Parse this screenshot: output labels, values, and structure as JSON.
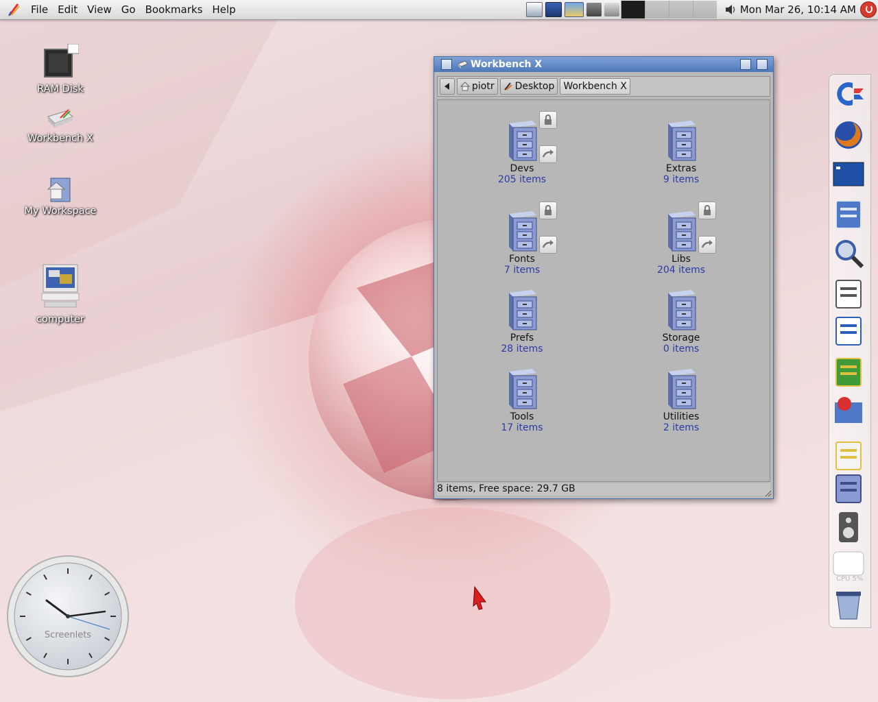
{
  "topbar": {
    "menu": [
      "File",
      "Edit",
      "View",
      "Go",
      "Bookmarks",
      "Help"
    ],
    "datetime": "Mon Mar 26, 10:14 AM"
  },
  "desktop": {
    "icons": [
      {
        "label": "RAM Disk",
        "icon": "ram-disk-icon"
      },
      {
        "label": "Workbench X",
        "icon": "workbench-drive-icon"
      },
      {
        "label": "My Workspace",
        "icon": "workspace-icon"
      },
      {
        "label": "computer",
        "icon": "computer-icon"
      }
    ]
  },
  "window": {
    "title": "Workbench X",
    "path": [
      "piotr",
      "Desktop",
      "Workbench X"
    ],
    "items": [
      {
        "name": "Devs",
        "count": "205 items",
        "locked": true,
        "link": true
      },
      {
        "name": "Extras",
        "count": "9 items",
        "locked": false,
        "link": false
      },
      {
        "name": "Fonts",
        "count": "7 items",
        "locked": true,
        "link": true
      },
      {
        "name": "Libs",
        "count": "204 items",
        "locked": true,
        "link": true
      },
      {
        "name": "Prefs",
        "count": "28 items",
        "locked": false,
        "link": false
      },
      {
        "name": "Storage",
        "count": "0 items",
        "locked": false,
        "link": false
      },
      {
        "name": "Tools",
        "count": "17 items",
        "locked": false,
        "link": false
      },
      {
        "name": "Utilities",
        "count": "2 items",
        "locked": false,
        "link": false
      }
    ],
    "status": "8 items, Free space: 29.7 GB"
  },
  "dock": {
    "items": [
      "commodore-icon",
      "firefox-icon",
      "terminal-icon",
      "software-icon",
      "search-icon",
      "screenshot-icon",
      "writer-document-icon",
      "chip-icon",
      "recorder-icon",
      "mail-lock-icon",
      "cabinet-icon",
      "speaker-icon",
      "cpu-monitor-icon",
      "trash-icon"
    ],
    "cpu_label": "CPU 5%"
  },
  "clock_widget": {
    "label": "Screenlets"
  },
  "colors": {
    "titlebar": "#5a82c0",
    "count_text": "#2b3aa6",
    "accent_red": "#d63b2b"
  }
}
